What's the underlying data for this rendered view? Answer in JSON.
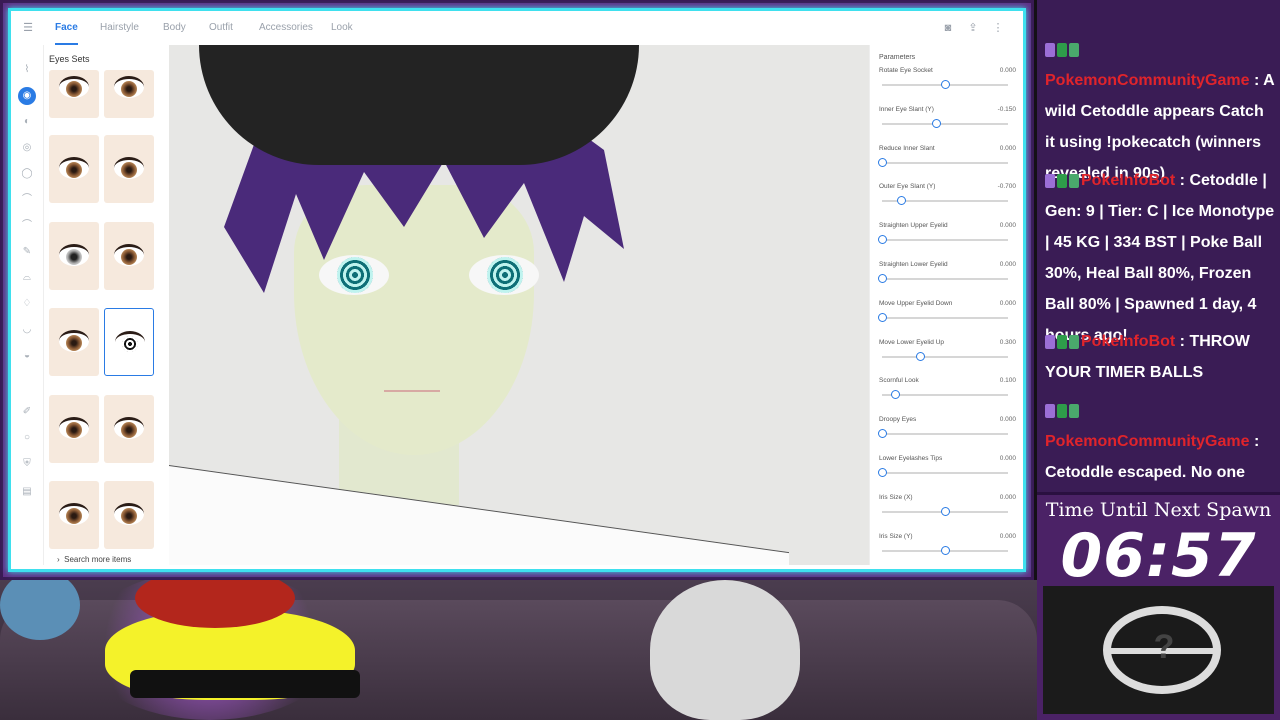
{
  "app": {
    "tabs": [
      {
        "label": "Face",
        "active": true
      },
      {
        "label": "Hairstyle",
        "active": false
      },
      {
        "label": "Body",
        "active": false
      },
      {
        "label": "Outfit",
        "active": false
      },
      {
        "label": "Accessories",
        "active": false
      },
      {
        "label": "Look",
        "active": false
      }
    ],
    "panel_title": "Eyes Sets",
    "search_more": "Search more items",
    "params_title": "Parameters",
    "params": [
      {
        "label": "Rotate Eye Socket",
        "value": "0.000",
        "fraction": 0.5
      },
      {
        "label": "Inner Eye Slant (Y)",
        "value": "-0.150",
        "fraction": 0.43
      },
      {
        "label": "Reduce Inner Slant",
        "value": "0.000",
        "fraction": 0.0
      },
      {
        "label": "Outer Eye Slant (Y)",
        "value": "-0.700",
        "fraction": 0.15
      },
      {
        "label": "Straighten Upper Eyelid",
        "value": "0.000",
        "fraction": 0.0
      },
      {
        "label": "Straighten Lower Eyelid",
        "value": "0.000",
        "fraction": 0.0
      },
      {
        "label": "Move Upper Eyelid Down",
        "value": "0.000",
        "fraction": 0.0
      },
      {
        "label": "Move Lower Eyelid Up",
        "value": "0.300",
        "fraction": 0.3
      },
      {
        "label": "Scornful Look",
        "value": "0.100",
        "fraction": 0.1
      },
      {
        "label": "Droopy Eyes",
        "value": "0.000",
        "fraction": 0.0
      },
      {
        "label": "Lower Eyelashes Tips",
        "value": "0.000",
        "fraction": 0.0
      },
      {
        "label": "Iris Size (X)",
        "value": "0.000",
        "fraction": 0.5
      },
      {
        "label": "Iris Size (Y)",
        "value": "0.000",
        "fraction": 0.5
      }
    ]
  },
  "chat": {
    "lines": [
      {
        "user": "PokemonCommunityGame",
        "text": ": A wild Cetoddle appears Catch it using !pokecatch (winners revealed in 90s)"
      },
      {
        "user": "PokeInfoBot",
        "text": ": Cetoddle | Gen: 9 | Tier: C | Ice Monotype | 45 KG | 334 BST | Poke Ball 30%, Heal Ball 80%, Frozen Ball 80% | Spawned 1 day, 4 hours ago!"
      },
      {
        "user": "PokeInfoBot",
        "text": ": THROW YOUR TIMER BALLS"
      },
      {
        "user": "PokemonCommunityGame",
        "text": ": Cetoddle escaped. No one caught it."
      }
    ],
    "colors": {
      "username": "#e0242b",
      "text": "#ffffff",
      "background": "#3a1c55"
    }
  },
  "timer": {
    "label": "Time Until Next Spawn",
    "value": "06:57"
  },
  "pokeball": {
    "symbol": "?"
  },
  "colors": {
    "accent": "#2a7be4",
    "frame_border": "#3fe0ee",
    "frame_bg": "#5f2f86"
  }
}
